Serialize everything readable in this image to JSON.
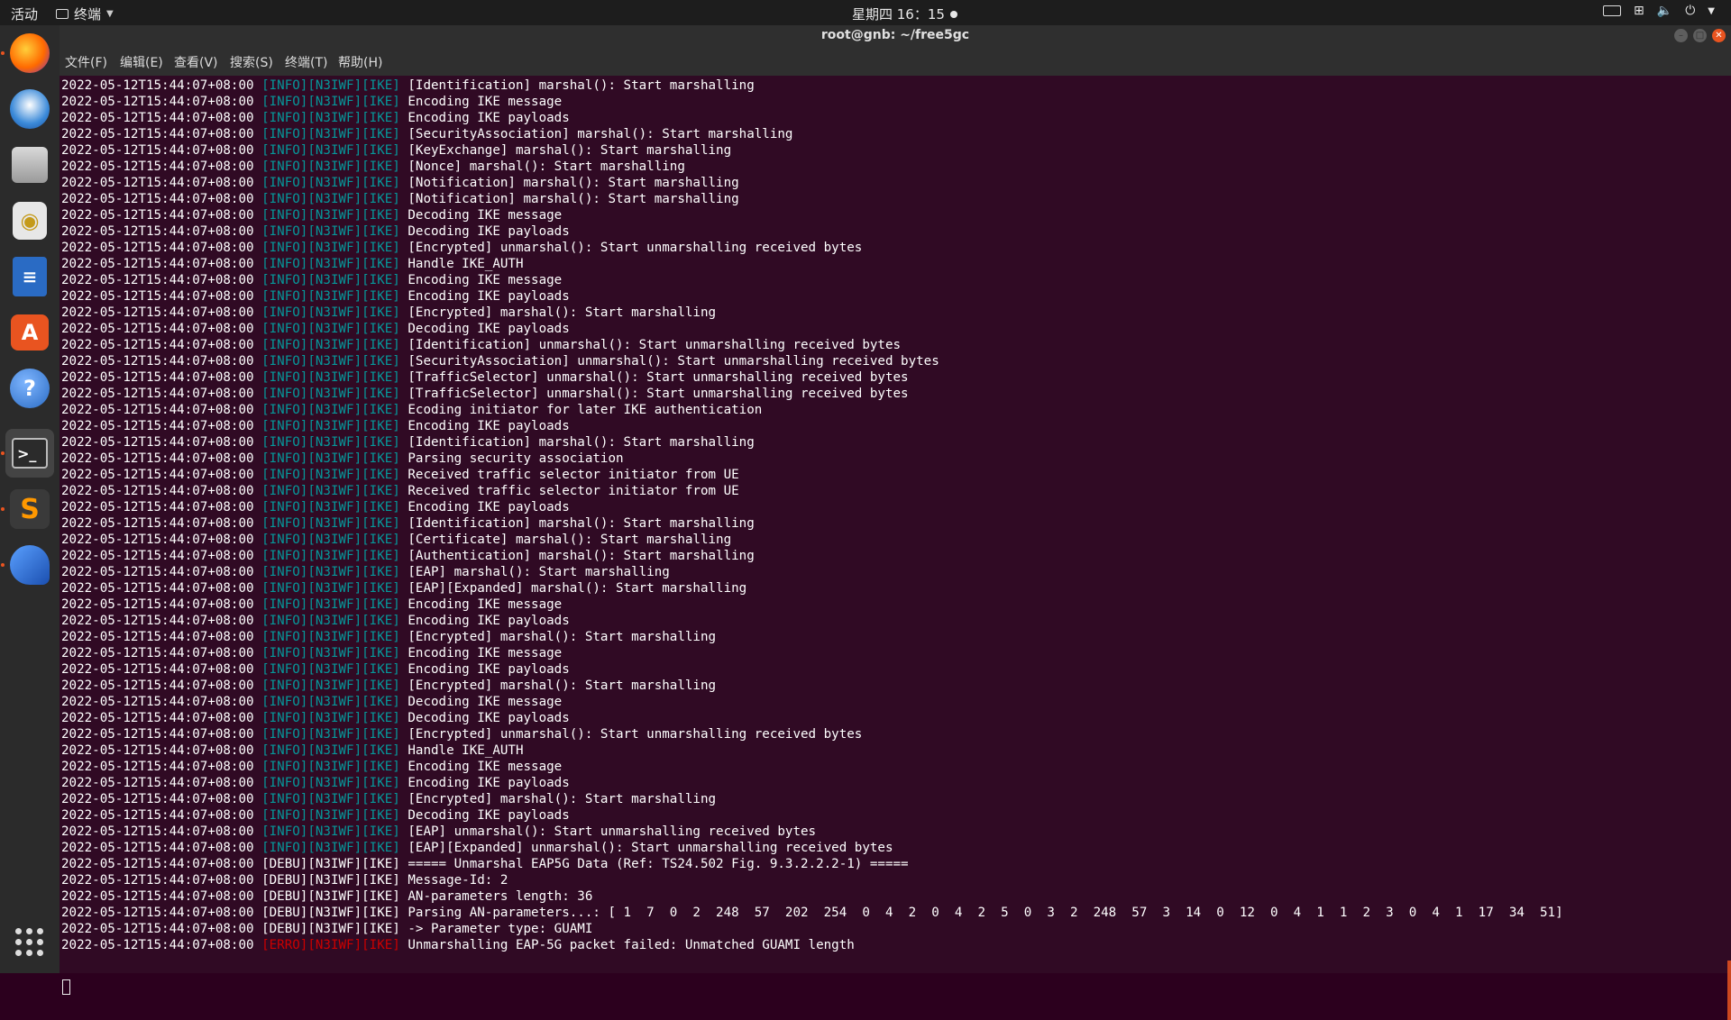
{
  "topbar": {
    "activities": "活动",
    "app_name": "终端",
    "clock": "星期四 16：15"
  },
  "dock": {
    "items": [
      {
        "name": "firefox-icon",
        "running": true
      },
      {
        "name": "thunderbird-icon",
        "running": false
      },
      {
        "name": "files-icon",
        "running": false
      },
      {
        "name": "rhythmbox-icon",
        "running": false
      },
      {
        "name": "writer-icon",
        "running": false
      },
      {
        "name": "software-center-icon",
        "running": false
      },
      {
        "name": "help-icon",
        "running": false
      },
      {
        "name": "terminal-icon",
        "running": true
      },
      {
        "name": "sublime-text-icon",
        "running": true
      },
      {
        "name": "wireshark-icon",
        "running": true
      }
    ]
  },
  "window": {
    "title": "root@gnb: ~/free5gc"
  },
  "menubar": {
    "items": [
      "文件(F)",
      "编辑(E)",
      "查看(V)",
      "搜索(S)",
      "终端(T)",
      "帮助(H)"
    ]
  },
  "colors": {
    "terminal_bg": "#300a24",
    "info_tag": "#06989a",
    "error_tag": "#cc0000",
    "accent": "#e95420"
  },
  "terminal": {
    "lines": [
      {
        "ts": "2022-05-12T15:44:07+08:00",
        "tag": "[INFO][N3IWF][IKE]",
        "level": "info",
        "msg": "[Identification] marshal(): Start marshalling"
      },
      {
        "ts": "2022-05-12T15:44:07+08:00",
        "tag": "[INFO][N3IWF][IKE]",
        "level": "info",
        "msg": "Encoding IKE message"
      },
      {
        "ts": "2022-05-12T15:44:07+08:00",
        "tag": "[INFO][N3IWF][IKE]",
        "level": "info",
        "msg": "Encoding IKE payloads"
      },
      {
        "ts": "2022-05-12T15:44:07+08:00",
        "tag": "[INFO][N3IWF][IKE]",
        "level": "info",
        "msg": "[SecurityAssociation] marshal(): Start marshalling"
      },
      {
        "ts": "2022-05-12T15:44:07+08:00",
        "tag": "[INFO][N3IWF][IKE]",
        "level": "info",
        "msg": "[KeyExchange] marshal(): Start marshalling"
      },
      {
        "ts": "2022-05-12T15:44:07+08:00",
        "tag": "[INFO][N3IWF][IKE]",
        "level": "info",
        "msg": "[Nonce] marshal(): Start marshalling"
      },
      {
        "ts": "2022-05-12T15:44:07+08:00",
        "tag": "[INFO][N3IWF][IKE]",
        "level": "info",
        "msg": "[Notification] marshal(): Start marshalling"
      },
      {
        "ts": "2022-05-12T15:44:07+08:00",
        "tag": "[INFO][N3IWF][IKE]",
        "level": "info",
        "msg": "[Notification] marshal(): Start marshalling"
      },
      {
        "ts": "2022-05-12T15:44:07+08:00",
        "tag": "[INFO][N3IWF][IKE]",
        "level": "info",
        "msg": "Decoding IKE message"
      },
      {
        "ts": "2022-05-12T15:44:07+08:00",
        "tag": "[INFO][N3IWF][IKE]",
        "level": "info",
        "msg": "Decoding IKE payloads"
      },
      {
        "ts": "2022-05-12T15:44:07+08:00",
        "tag": "[INFO][N3IWF][IKE]",
        "level": "info",
        "msg": "[Encrypted] unmarshal(): Start unmarshalling received bytes"
      },
      {
        "ts": "2022-05-12T15:44:07+08:00",
        "tag": "[INFO][N3IWF][IKE]",
        "level": "info",
        "msg": "Handle IKE_AUTH"
      },
      {
        "ts": "2022-05-12T15:44:07+08:00",
        "tag": "[INFO][N3IWF][IKE]",
        "level": "info",
        "msg": "Encoding IKE message"
      },
      {
        "ts": "2022-05-12T15:44:07+08:00",
        "tag": "[INFO][N3IWF][IKE]",
        "level": "info",
        "msg": "Encoding IKE payloads"
      },
      {
        "ts": "2022-05-12T15:44:07+08:00",
        "tag": "[INFO][N3IWF][IKE]",
        "level": "info",
        "msg": "[Encrypted] marshal(): Start marshalling"
      },
      {
        "ts": "2022-05-12T15:44:07+08:00",
        "tag": "[INFO][N3IWF][IKE]",
        "level": "info",
        "msg": "Decoding IKE payloads"
      },
      {
        "ts": "2022-05-12T15:44:07+08:00",
        "tag": "[INFO][N3IWF][IKE]",
        "level": "info",
        "msg": "[Identification] unmarshal(): Start unmarshalling received bytes"
      },
      {
        "ts": "2022-05-12T15:44:07+08:00",
        "tag": "[INFO][N3IWF][IKE]",
        "level": "info",
        "msg": "[SecurityAssociation] unmarshal(): Start unmarshalling received bytes"
      },
      {
        "ts": "2022-05-12T15:44:07+08:00",
        "tag": "[INFO][N3IWF][IKE]",
        "level": "info",
        "msg": "[TrafficSelector] unmarshal(): Start unmarshalling received bytes"
      },
      {
        "ts": "2022-05-12T15:44:07+08:00",
        "tag": "[INFO][N3IWF][IKE]",
        "level": "info",
        "msg": "[TrafficSelector] unmarshal(): Start unmarshalling received bytes"
      },
      {
        "ts": "2022-05-12T15:44:07+08:00",
        "tag": "[INFO][N3IWF][IKE]",
        "level": "info",
        "msg": "Ecoding initiator for later IKE authentication"
      },
      {
        "ts": "2022-05-12T15:44:07+08:00",
        "tag": "[INFO][N3IWF][IKE]",
        "level": "info",
        "msg": "Encoding IKE payloads"
      },
      {
        "ts": "2022-05-12T15:44:07+08:00",
        "tag": "[INFO][N3IWF][IKE]",
        "level": "info",
        "msg": "[Identification] marshal(): Start marshalling"
      },
      {
        "ts": "2022-05-12T15:44:07+08:00",
        "tag": "[INFO][N3IWF][IKE]",
        "level": "info",
        "msg": "Parsing security association"
      },
      {
        "ts": "2022-05-12T15:44:07+08:00",
        "tag": "[INFO][N3IWF][IKE]",
        "level": "info",
        "msg": "Received traffic selector initiator from UE"
      },
      {
        "ts": "2022-05-12T15:44:07+08:00",
        "tag": "[INFO][N3IWF][IKE]",
        "level": "info",
        "msg": "Received traffic selector initiator from UE"
      },
      {
        "ts": "2022-05-12T15:44:07+08:00",
        "tag": "[INFO][N3IWF][IKE]",
        "level": "info",
        "msg": "Encoding IKE payloads"
      },
      {
        "ts": "2022-05-12T15:44:07+08:00",
        "tag": "[INFO][N3IWF][IKE]",
        "level": "info",
        "msg": "[Identification] marshal(): Start marshalling"
      },
      {
        "ts": "2022-05-12T15:44:07+08:00",
        "tag": "[INFO][N3IWF][IKE]",
        "level": "info",
        "msg": "[Certificate] marshal(): Start marshalling"
      },
      {
        "ts": "2022-05-12T15:44:07+08:00",
        "tag": "[INFO][N3IWF][IKE]",
        "level": "info",
        "msg": "[Authentication] marshal(): Start marshalling"
      },
      {
        "ts": "2022-05-12T15:44:07+08:00",
        "tag": "[INFO][N3IWF][IKE]",
        "level": "info",
        "msg": "[EAP] marshal(): Start marshalling"
      },
      {
        "ts": "2022-05-12T15:44:07+08:00",
        "tag": "[INFO][N3IWF][IKE]",
        "level": "info",
        "msg": "[EAP][Expanded] marshal(): Start marshalling"
      },
      {
        "ts": "2022-05-12T15:44:07+08:00",
        "tag": "[INFO][N3IWF][IKE]",
        "level": "info",
        "msg": "Encoding IKE message"
      },
      {
        "ts": "2022-05-12T15:44:07+08:00",
        "tag": "[INFO][N3IWF][IKE]",
        "level": "info",
        "msg": "Encoding IKE payloads"
      },
      {
        "ts": "2022-05-12T15:44:07+08:00",
        "tag": "[INFO][N3IWF][IKE]",
        "level": "info",
        "msg": "[Encrypted] marshal(): Start marshalling"
      },
      {
        "ts": "2022-05-12T15:44:07+08:00",
        "tag": "[INFO][N3IWF][IKE]",
        "level": "info",
        "msg": "Encoding IKE message"
      },
      {
        "ts": "2022-05-12T15:44:07+08:00",
        "tag": "[INFO][N3IWF][IKE]",
        "level": "info",
        "msg": "Encoding IKE payloads"
      },
      {
        "ts": "2022-05-12T15:44:07+08:00",
        "tag": "[INFO][N3IWF][IKE]",
        "level": "info",
        "msg": "[Encrypted] marshal(): Start marshalling"
      },
      {
        "ts": "2022-05-12T15:44:07+08:00",
        "tag": "[INFO][N3IWF][IKE]",
        "level": "info",
        "msg": "Decoding IKE message"
      },
      {
        "ts": "2022-05-12T15:44:07+08:00",
        "tag": "[INFO][N3IWF][IKE]",
        "level": "info",
        "msg": "Decoding IKE payloads"
      },
      {
        "ts": "2022-05-12T15:44:07+08:00",
        "tag": "[INFO][N3IWF][IKE]",
        "level": "info",
        "msg": "[Encrypted] unmarshal(): Start unmarshalling received bytes"
      },
      {
        "ts": "2022-05-12T15:44:07+08:00",
        "tag": "[INFO][N3IWF][IKE]",
        "level": "info",
        "msg": "Handle IKE_AUTH"
      },
      {
        "ts": "2022-05-12T15:44:07+08:00",
        "tag": "[INFO][N3IWF][IKE]",
        "level": "info",
        "msg": "Encoding IKE message"
      },
      {
        "ts": "2022-05-12T15:44:07+08:00",
        "tag": "[INFO][N3IWF][IKE]",
        "level": "info",
        "msg": "Encoding IKE payloads"
      },
      {
        "ts": "2022-05-12T15:44:07+08:00",
        "tag": "[INFO][N3IWF][IKE]",
        "level": "info",
        "msg": "[Encrypted] marshal(): Start marshalling"
      },
      {
        "ts": "2022-05-12T15:44:07+08:00",
        "tag": "[INFO][N3IWF][IKE]",
        "level": "info",
        "msg": "Decoding IKE payloads"
      },
      {
        "ts": "2022-05-12T15:44:07+08:00",
        "tag": "[INFO][N3IWF][IKE]",
        "level": "info",
        "msg": "[EAP] unmarshal(): Start unmarshalling received bytes"
      },
      {
        "ts": "2022-05-12T15:44:07+08:00",
        "tag": "[INFO][N3IWF][IKE]",
        "level": "info",
        "msg": "[EAP][Expanded] unmarshal(): Start unmarshalling received bytes"
      },
      {
        "ts": "2022-05-12T15:44:07+08:00",
        "tag": "[DEBU][N3IWF][IKE]",
        "level": "debu",
        "msg": "===== Unmarshal EAP5G Data (Ref: TS24.502 Fig. 9.3.2.2.2-1) ====="
      },
      {
        "ts": "2022-05-12T15:44:07+08:00",
        "tag": "[DEBU][N3IWF][IKE]",
        "level": "debu",
        "msg": "Message-Id: 2"
      },
      {
        "ts": "2022-05-12T15:44:07+08:00",
        "tag": "[DEBU][N3IWF][IKE]",
        "level": "debu",
        "msg": "AN-parameters length: 36"
      },
      {
        "ts": "2022-05-12T15:44:07+08:00",
        "tag": "[DEBU][N3IWF][IKE]",
        "level": "debu",
        "msg": "Parsing AN-parameters...: [ 1  7  0  2  248  57  202  254  0  4  2  0  4  2  5  0  3  2  248  57  3  14  0  12  0  4  1  1  2  3  0  4  1  17  34  51]"
      },
      {
        "ts": "2022-05-12T15:44:07+08:00",
        "tag": "[DEBU][N3IWF][IKE]",
        "level": "debu",
        "msg": "-> Parameter type: GUAMI"
      },
      {
        "ts": "2022-05-12T15:44:07+08:00",
        "tag": "[ERRO][N3IWF][IKE]",
        "level": "erro",
        "msg": "Unmarshalling EAP-5G packet failed: Unmatched GUAMI length"
      }
    ]
  }
}
